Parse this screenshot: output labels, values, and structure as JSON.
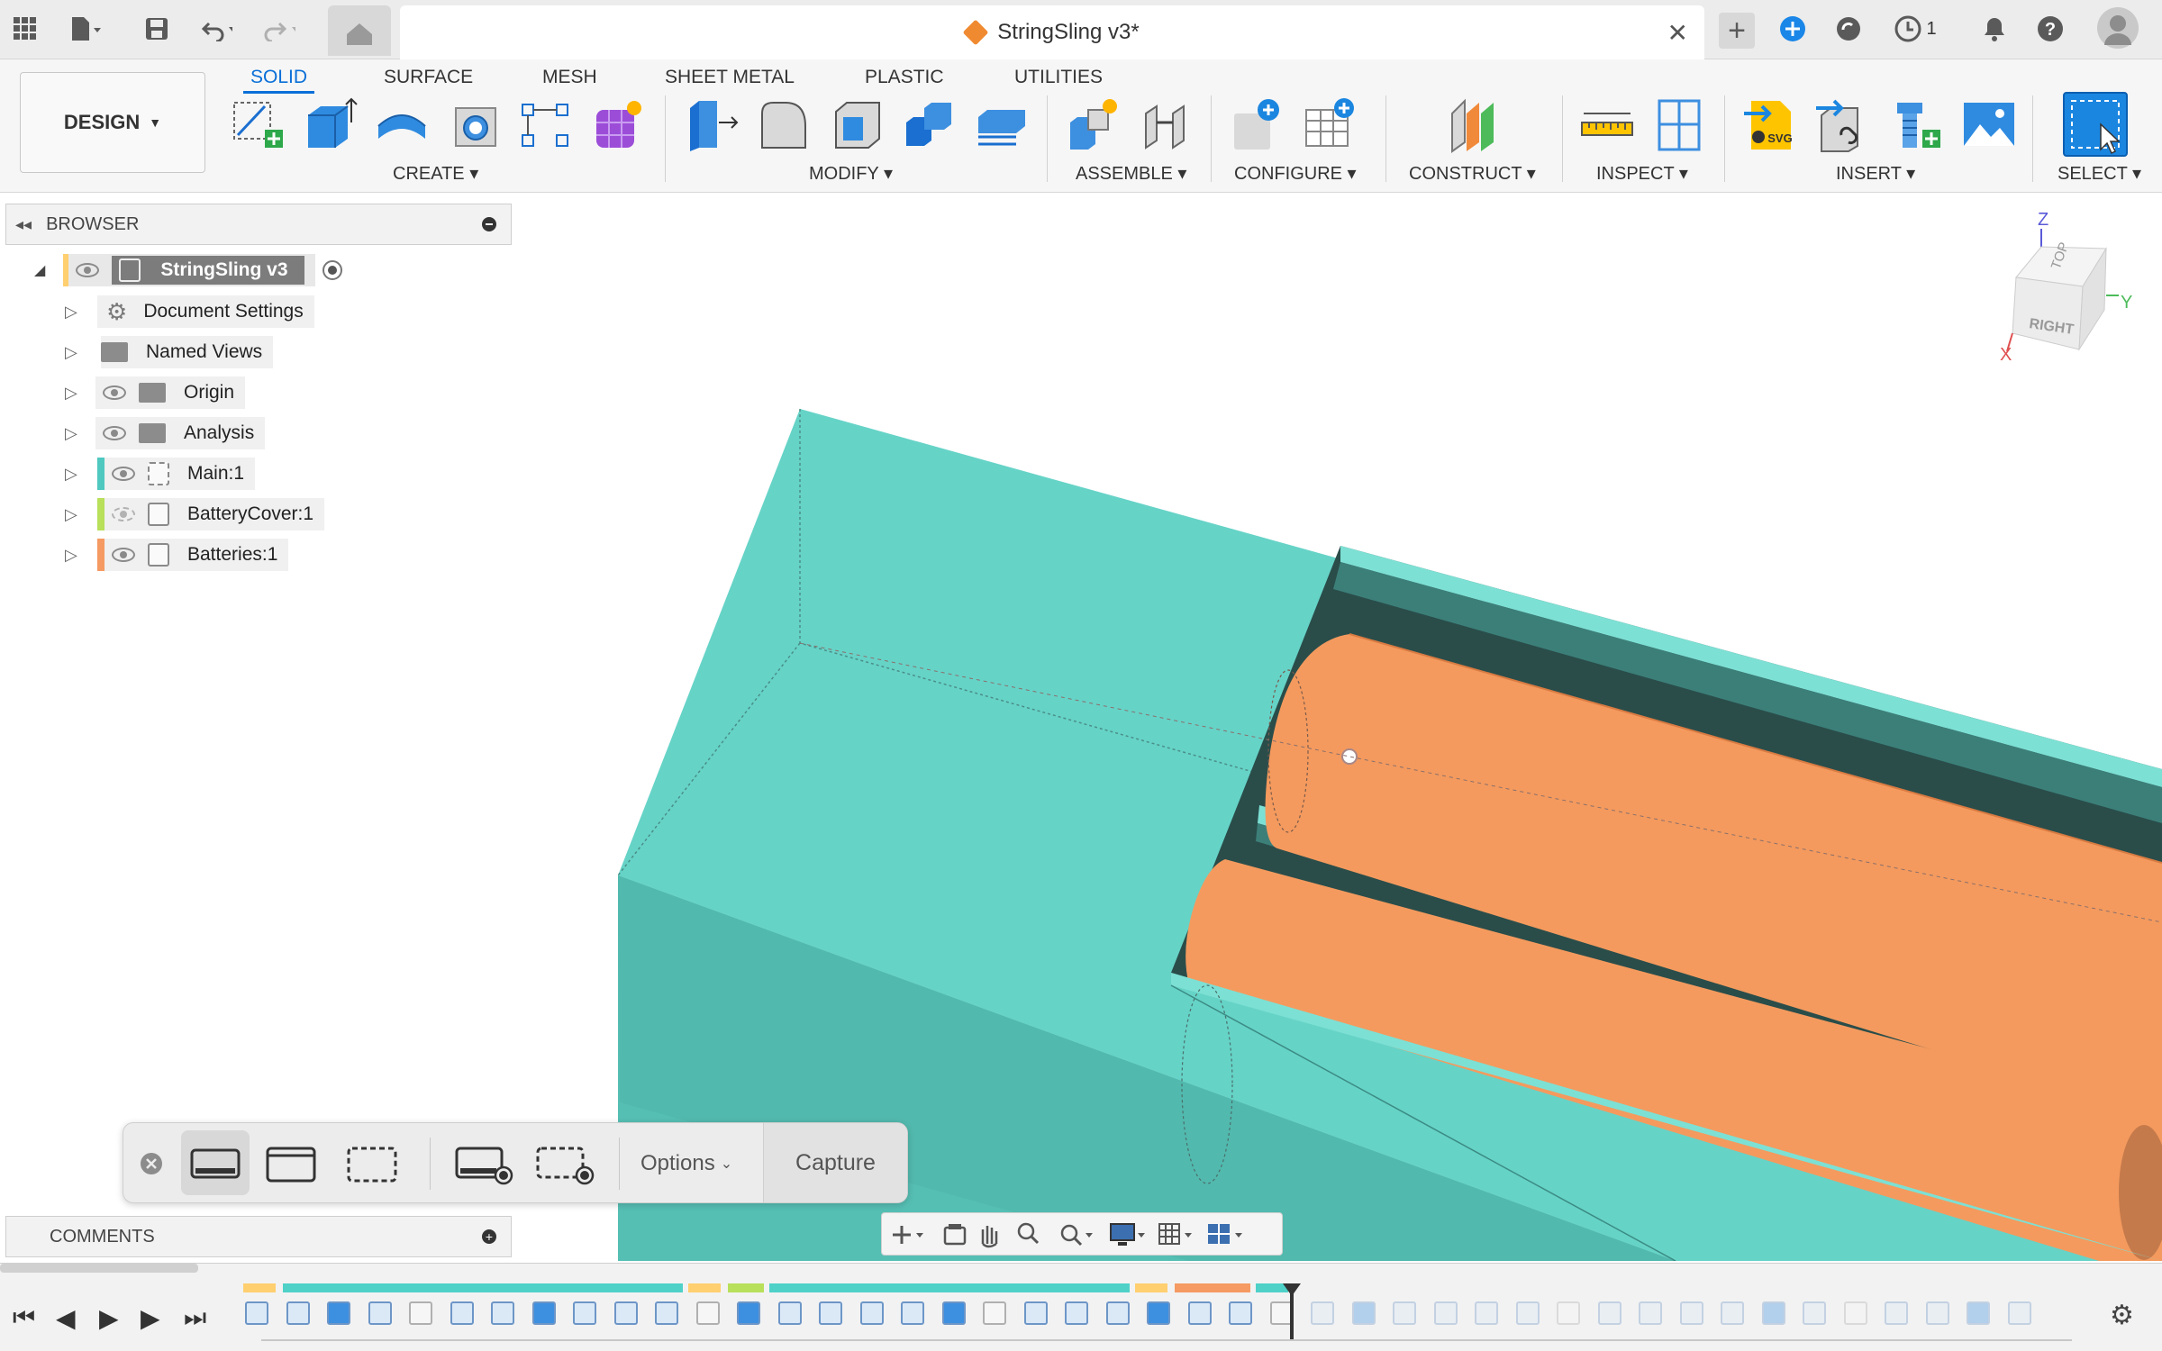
{
  "window": {
    "document_title": "StringSling v3*",
    "jobs_count": "1"
  },
  "ribbon": {
    "workspace_button": "DESIGN",
    "tabs": [
      "SOLID",
      "SURFACE",
      "MESH",
      "SHEET METAL",
      "PLASTIC",
      "UTILITIES"
    ],
    "active_tab": "SOLID",
    "groups": {
      "create": "CREATE",
      "modify": "MODIFY",
      "assemble": "ASSEMBLE",
      "configure": "CONFIGURE",
      "construct": "CONSTRUCT",
      "inspect": "INSPECT",
      "insert": "INSERT",
      "select": "SELECT"
    },
    "insert_svg_badge": "SVG"
  },
  "browser": {
    "title": "BROWSER",
    "root": "StringSling v3",
    "items": [
      {
        "label": "Document Settings",
        "icon": "gear-icon"
      },
      {
        "label": "Named Views",
        "icon": "folder-icon"
      },
      {
        "label": "Origin",
        "icon": "folder-icon"
      },
      {
        "label": "Analysis",
        "icon": "folder-icon"
      },
      {
        "label": "Main:1",
        "icon": "component-icon",
        "color": "#4fc8c0"
      },
      {
        "label": "BatteryCover:1",
        "icon": "component-icon",
        "color": "#b8e05a"
      },
      {
        "label": "Batteries:1",
        "icon": "component-icon",
        "color": "#f59a62"
      }
    ]
  },
  "viewcube": {
    "top_face": "TOP",
    "right_face": "RIGHT",
    "axis_z": "Z",
    "axis_y": "Y",
    "axis_x": "X"
  },
  "comments": {
    "title": "COMMENTS"
  },
  "capture_bar": {
    "options_label": "Options",
    "capture_label": "Capture"
  },
  "colors": {
    "accent": "#0a6fd8",
    "body_teal": "#5fd3c6",
    "battery_orange": "#f49a5e"
  }
}
